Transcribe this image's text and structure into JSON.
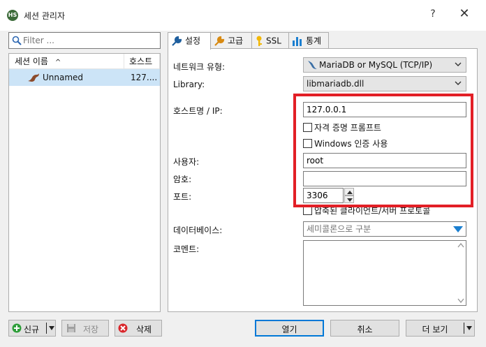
{
  "window": {
    "app_icon_text": "HS",
    "title": "세션 관리자",
    "help": "?",
    "close": "✕"
  },
  "filter": {
    "placeholder": "Filter ..."
  },
  "tree": {
    "col_name": "세션 이름",
    "sort_glyph": "^",
    "col_host": "호스트",
    "rows": [
      {
        "name": "Unnamed",
        "host": "127...."
      }
    ]
  },
  "tabs": [
    {
      "label": "설정",
      "icon": "wrench-icon",
      "active": true
    },
    {
      "label": "고급",
      "icon": "wrench-icon"
    },
    {
      "label": "SSL",
      "icon": "key-icon"
    },
    {
      "label": "통계",
      "icon": "chart-icon"
    }
  ],
  "settings": {
    "network_type_label": "네트워크 유형:",
    "network_type_value": "MariaDB or MySQL (TCP/IP)",
    "library_label": "Library:",
    "library_value": "libmariadb.dll",
    "host_label": "호스트명 / IP:",
    "host_value": "127.0.0.1",
    "prompt_credentials": "자격 증명 프롬프트",
    "windows_auth": "Windows 인증 사용",
    "user_label": "사용자:",
    "user_value": "root",
    "password_label": "암호:",
    "password_value": "",
    "port_label": "포트:",
    "port_value": "3306",
    "compressed_protocol": "압축된 클라이언트/서버 프로토콜",
    "database_label": "데이터베이스:",
    "database_placeholder": "세미콜론으로 구분",
    "comment_label": "코멘트:",
    "comment_value": ""
  },
  "buttons": {
    "new": "신규",
    "save": "저장",
    "delete": "삭제",
    "open": "열기",
    "cancel": "취소",
    "more": "더 보기"
  },
  "colors": {
    "highlight": "#e21f26",
    "selection": "#cce4f7",
    "accent": "#0078d7"
  }
}
